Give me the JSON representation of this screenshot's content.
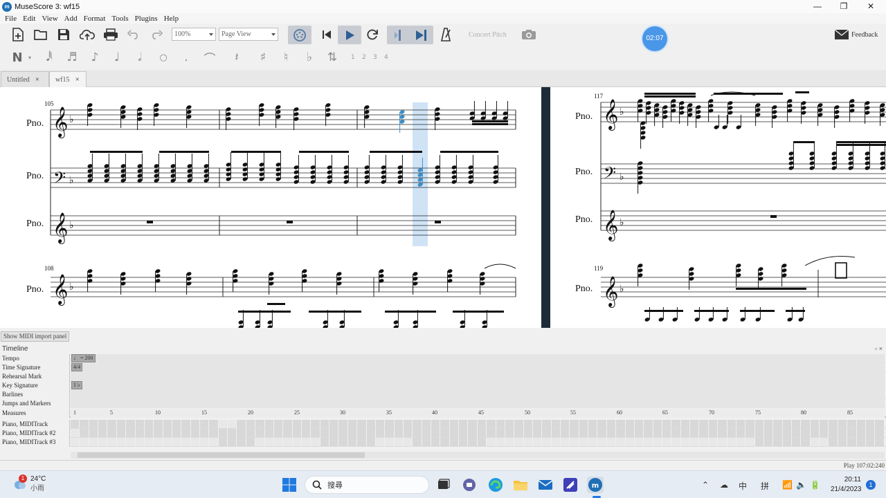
{
  "window": {
    "title": "MuseScore 3: wf15",
    "minimize": "—",
    "maximize": "❐",
    "close": "✕"
  },
  "menu": [
    "File",
    "Edit",
    "View",
    "Add",
    "Format",
    "Tools",
    "Plugins",
    "Help"
  ],
  "toolbar": {
    "zoom": "100%",
    "view_mode": "Page View",
    "concert_pitch": "Concert Pitch",
    "feedback": "Feedback",
    "timer": "02:07"
  },
  "note_input": {
    "voices": [
      "1",
      "2",
      "3",
      "4"
    ]
  },
  "tabs": [
    {
      "label": "Untitled",
      "close": "×"
    },
    {
      "label": "wf15",
      "close": "×"
    }
  ],
  "score": {
    "instrument": "Pno.",
    "measure_numbers": [
      "105",
      "108",
      "117",
      "119"
    ]
  },
  "midi_button": "Show MIDI import panel",
  "timeline": {
    "title": "Timeline",
    "controls": "▫ ×",
    "rows": [
      "Tempo",
      "Time Signature",
      "Rehearsal Mark",
      "Key Signature",
      "Barlines",
      "Jumps and Markers",
      "Measures"
    ],
    "tempo_chip": "♩ = 200",
    "timesig_chip": "4/4",
    "keysig_chip": "1 ♭",
    "measure_labels": [
      "1",
      "5",
      "10",
      "15",
      "20",
      "25",
      "30",
      "35",
      "40",
      "45",
      "50",
      "55",
      "60",
      "65",
      "70",
      "75",
      "80",
      "85"
    ],
    "tracks": [
      "Piano, MIDITrack",
      "Piano, MIDITrack #2",
      "Piano, MIDITrack #3"
    ]
  },
  "status": "Play 107:02:240",
  "taskbar": {
    "weather_temp": "24°C",
    "weather_desc": "小雨",
    "weather_badge": "1",
    "search_placeholder": "搜尋",
    "time": "20:11",
    "date": "21/4/2023",
    "ime1": "中",
    "ime2": "拼",
    "notify_badge": "1"
  }
}
